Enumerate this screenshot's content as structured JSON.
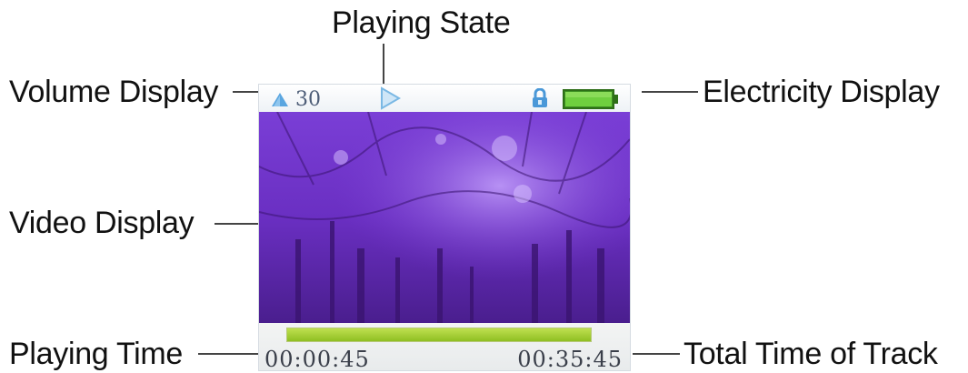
{
  "labels": {
    "playing_state": "Playing State",
    "volume_display": "Volume Display",
    "electricity_display": "Electricity Display",
    "video_display": "Video Display",
    "playing_time": "Playing Time",
    "total_time_of_track": "Total Time of Track"
  },
  "screen": {
    "volume_value": "30",
    "playing_time": "00:00:45",
    "total_time": "00:35:45",
    "progress_fraction": 1.0,
    "battery_level": 1.0,
    "icons": [
      "volume-icon",
      "play-icon",
      "lock-icon",
      "battery-icon"
    ]
  },
  "colors": {
    "status_icon_blue": "#5aa6e0",
    "battery_green": "#4caf2a",
    "progress_green": "#a6d03a",
    "video_purple": "#6a2fc2"
  }
}
